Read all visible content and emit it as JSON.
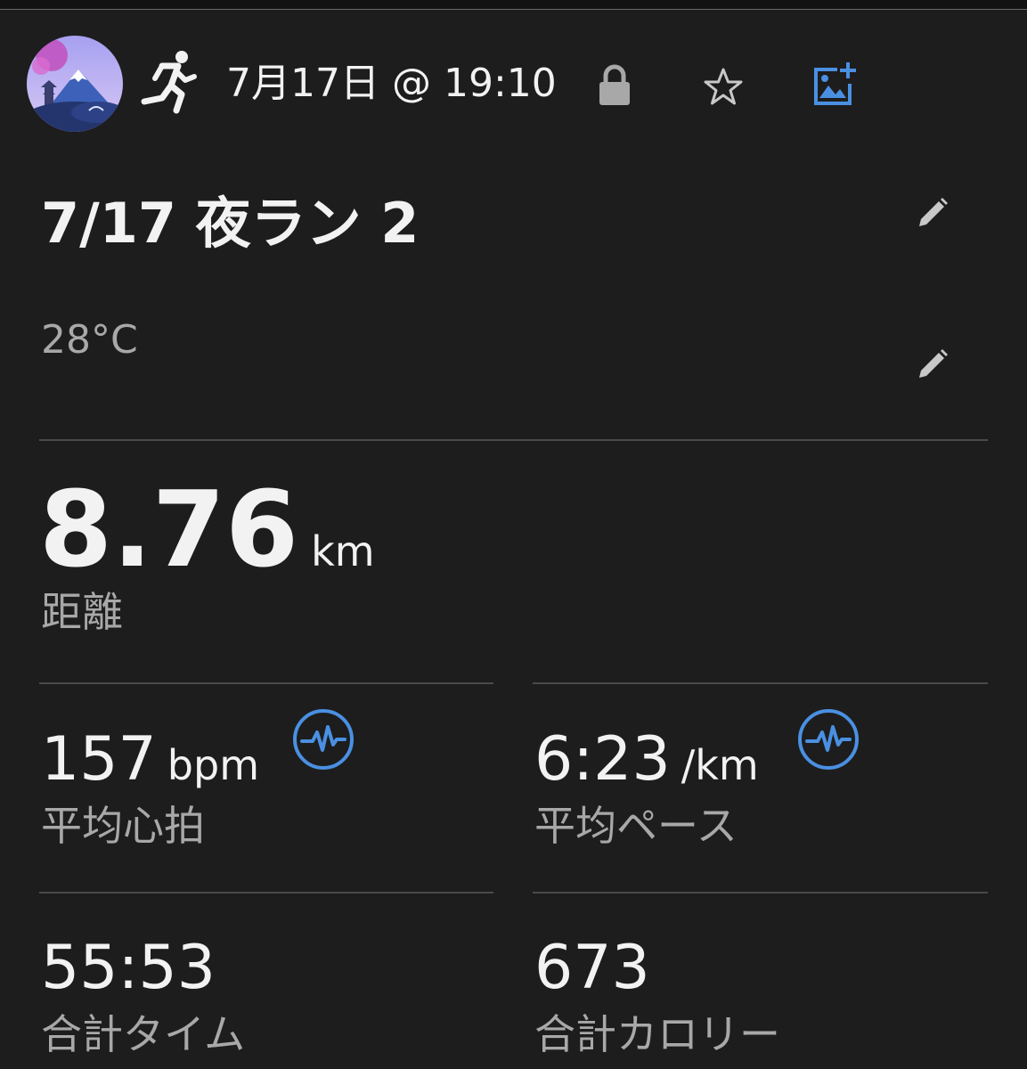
{
  "header": {
    "avatar": "profile-avatar-fuji-pagoda",
    "activity_icon": "running-icon",
    "date": "7月17日 @ 19:10",
    "privacy_icon": "lock-icon",
    "favorite_icon": "star-icon",
    "add_photo_icon": "add-photo-icon"
  },
  "activity": {
    "title": "7/17 夜ラン 2",
    "weather": "28°C"
  },
  "stats": {
    "distance": {
      "value": "8.76",
      "unit": "km",
      "label": "距離"
    },
    "avg_hr": {
      "value": "157",
      "unit": "bpm",
      "label": "平均心拍"
    },
    "avg_pace": {
      "value": "6:23",
      "unit": "/km",
      "label": "平均ペース"
    },
    "total_time": {
      "value": "55:53",
      "label": "合計タイム"
    },
    "total_calories": {
      "value": "673",
      "label": "合計カロリー"
    }
  },
  "colors": {
    "background": "#1d1d1e",
    "text_primary": "#f2f2f2",
    "text_secondary": "#a8a8a8",
    "accent_blue": "#4a90e2",
    "divider": "#4a4a4c"
  }
}
